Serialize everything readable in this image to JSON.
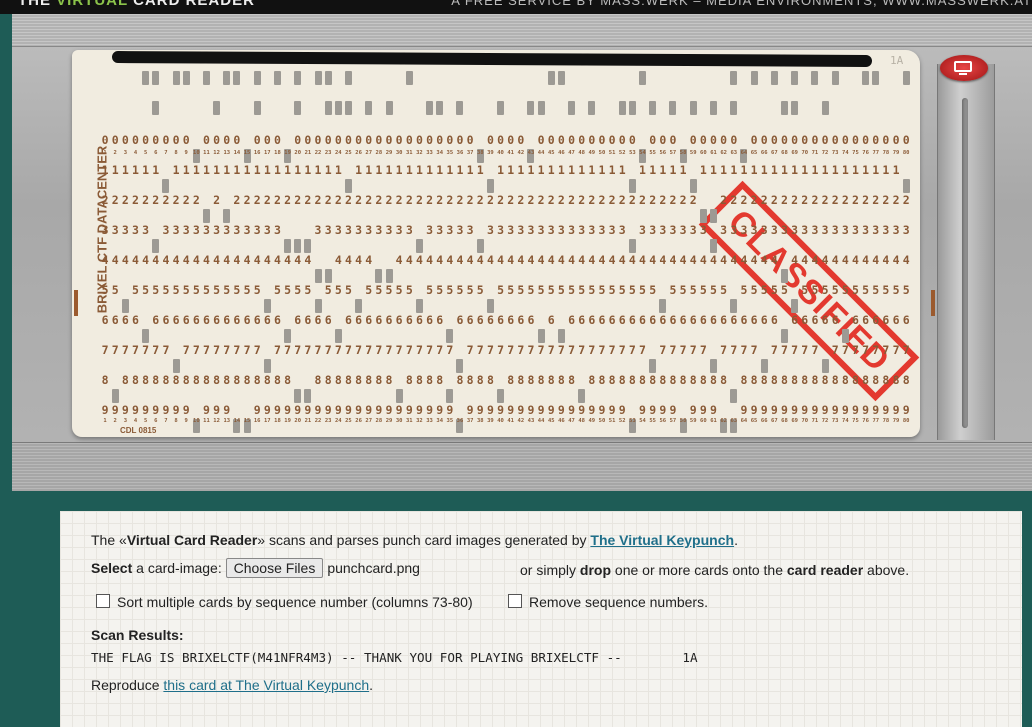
{
  "topbar": {
    "title_pre": "THE ",
    "title_accent": "VIRTUAL",
    "title_post": " CARD READER",
    "tagline": "A FREE SERVICE BY MASS:WERK – MEDIA ENVIRONMENTS, WWW.MASSWERK.AT"
  },
  "card": {
    "seq_label": "1A",
    "vertical_label": "BRIXEL CTF DATACENTER",
    "footer_code": "CDL 0815",
    "stamp_text": "CLASSIFIED",
    "digit_rows": [
      "0",
      "1",
      "2",
      "3",
      "4",
      "5",
      "6",
      "7",
      "8",
      "9"
    ],
    "punched_columns": {
      "r12": [
        5,
        6,
        8,
        9,
        11,
        13,
        14,
        16,
        18,
        20,
        22,
        23,
        25,
        31,
        45,
        46,
        54,
        63,
        65,
        67,
        69,
        71,
        73,
        76,
        77,
        80
      ],
      "r11": [
        6,
        12,
        16,
        20,
        23,
        24,
        25,
        27,
        29,
        33,
        34,
        36,
        40,
        43,
        44,
        47,
        49,
        52,
        53,
        55,
        57,
        59,
        61,
        63,
        68,
        69,
        72
      ],
      "r0": [
        10,
        15,
        19,
        38,
        43,
        54,
        58,
        64
      ],
      "r1": [
        7,
        25,
        39,
        53,
        59,
        80
      ],
      "r2": [
        11,
        13,
        60,
        61
      ],
      "r3": [
        6,
        19,
        20,
        21,
        32,
        38,
        53,
        61
      ],
      "r4": [
        22,
        23,
        28,
        29,
        68
      ],
      "r5": [
        3,
        17,
        22,
        26,
        32,
        39,
        56,
        63,
        69
      ],
      "r6": [
        5,
        19,
        24,
        35,
        44,
        46,
        68,
        74
      ],
      "r7": [
        8,
        17,
        36,
        55,
        61,
        66,
        72
      ],
      "r8": [
        2,
        20,
        21,
        30,
        35,
        40,
        48,
        63
      ],
      "r9": [
        10,
        14,
        15,
        36,
        53,
        58,
        62,
        63
      ]
    }
  },
  "panel": {
    "intro_pre": "The «",
    "intro_bold": "Virtual Card Reader",
    "intro_mid": "» scans and parses punch card images generated by ",
    "intro_link": "The Virtual Keypunch",
    "intro_post": ".",
    "select_bold": "Select",
    "select_text": " a card-image: ",
    "choose_button": "Choose Files",
    "file_name": "punchcard.png",
    "drop_pre": "or simply ",
    "drop_bold": "drop",
    "drop_mid": " one or more cards onto the ",
    "drop_bold2": "card reader",
    "drop_post": " above.",
    "sort_label": "Sort multiple cards by sequence number (columns 73-80)",
    "remove_label": "Remove sequence numbers.",
    "results_label": "Scan Results:",
    "result_text": "THE FLAG IS BRIXELCTF(M41NFR4M3) -- THANK YOU FOR PLAYING BRIXELCTF --        1A",
    "reproduce_pre": "Reproduce ",
    "reproduce_link": "this card at The Virtual Keypunch",
    "reproduce_post": "."
  },
  "colors": {
    "background": "#1e5c56",
    "card": "#f1ece0",
    "card_ink": "#8a5a36",
    "stamp": "#e2261c",
    "link": "#1f6f8a"
  }
}
